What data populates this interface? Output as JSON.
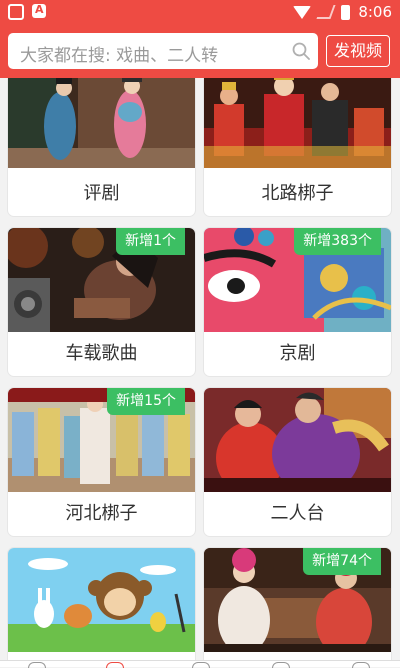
{
  "status_bar": {
    "time": "8:06"
  },
  "search": {
    "placeholder": "大家都在搜: 戏曲、二人转"
  },
  "header": {
    "post_video_label": "发视频"
  },
  "categories": [
    {
      "name": "评剧",
      "badge": ""
    },
    {
      "name": "北路梆子",
      "badge": ""
    },
    {
      "name": "车载歌曲",
      "badge": "新增1个"
    },
    {
      "name": "京剧",
      "badge": "新增383个"
    },
    {
      "name": "河北梆子",
      "badge": "新增15个"
    },
    {
      "name": "二人台",
      "badge": ""
    },
    {
      "name": "",
      "badge": ""
    },
    {
      "name": "",
      "badge": "新增74个"
    }
  ],
  "colors": {
    "accent": "#ee4b43",
    "badge": "#3cbf63"
  }
}
